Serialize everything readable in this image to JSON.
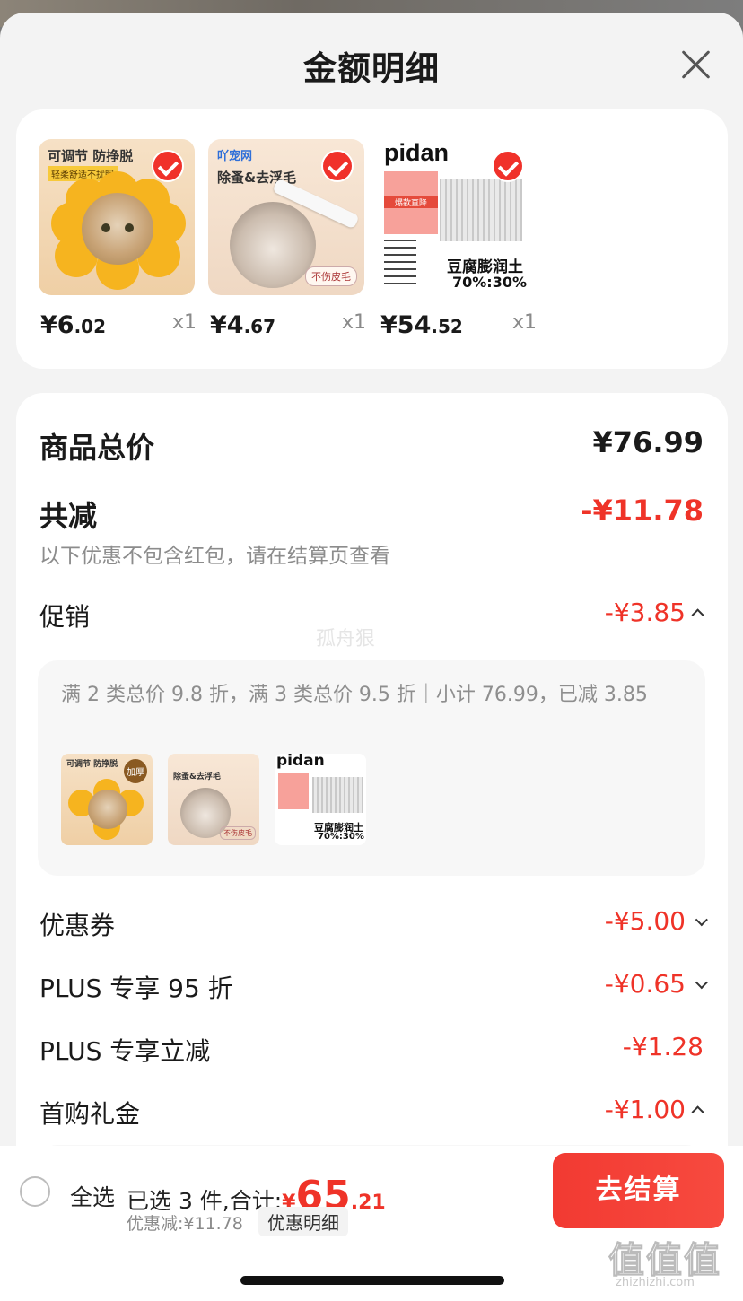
{
  "sheet": {
    "title": "金额明细"
  },
  "products": [
    {
      "price_int": "¥6",
      "price_dec": ".02",
      "qty": "x1",
      "img_title": "可调节 防挣脱",
      "img_sub": "轻柔舒适不扰眠"
    },
    {
      "price_int": "¥4",
      "price_dec": ".67",
      "qty": "x1",
      "img_brand": "吖宠网",
      "img_title": "除蚤&去浮毛",
      "img_tag": "不伤皮毛"
    },
    {
      "price_int": "¥54",
      "price_dec": ".52",
      "qty": "x1",
      "img_brand": "pidan",
      "img_badge": "爆款直降",
      "img_title": "豆腐膨润土",
      "img_ratio": "70%:30%"
    }
  ],
  "summary": {
    "goods_total_label": "商品总价",
    "goods_total_value": "¥76.99",
    "total_reduce_label": "共减",
    "total_reduce_value": "-¥11.78",
    "note": "以下优惠不包含红包，请在结算页查看"
  },
  "promo": {
    "label": "促销",
    "value": "-¥3.85",
    "detail": "满 2 类总价 9.8 折，满 3 类总价 9.5 折｜小计 76.99，已减 3.85",
    "mini_items": [
      {
        "title": "可调节 防挣脱",
        "badge": "加厚"
      },
      {
        "title": "除蚤&去浮毛",
        "tag": "不伤皮毛"
      },
      {
        "brand": "pidan",
        "title": "豆腐膨润土",
        "ratio": "70%:30%"
      }
    ]
  },
  "discounts": [
    {
      "label": "优惠券",
      "value": "-¥5.00"
    },
    {
      "label": "PLUS 专享 95 折",
      "value": "-¥0.65"
    },
    {
      "label": "PLUS 专享立减",
      "value": "-¥1.28"
    },
    {
      "label": "首购礼金",
      "value": "-¥1.00"
    }
  ],
  "watermark": "孤舟狠",
  "bottom": {
    "select_all": "全选",
    "selected_text": "已选 3 件,合计:",
    "total_sym": "¥",
    "total_int": "65",
    "total_dec": ".21",
    "discount_text": "优惠减:¥11.78",
    "detail_chip": "优惠明细",
    "checkout": "去结算"
  },
  "site_mark": {
    "glyphs": "值值值",
    "url": "zhizhizhi.com"
  },
  "colors": {
    "accent": "#ef3328",
    "checkout": "#f23a32"
  }
}
